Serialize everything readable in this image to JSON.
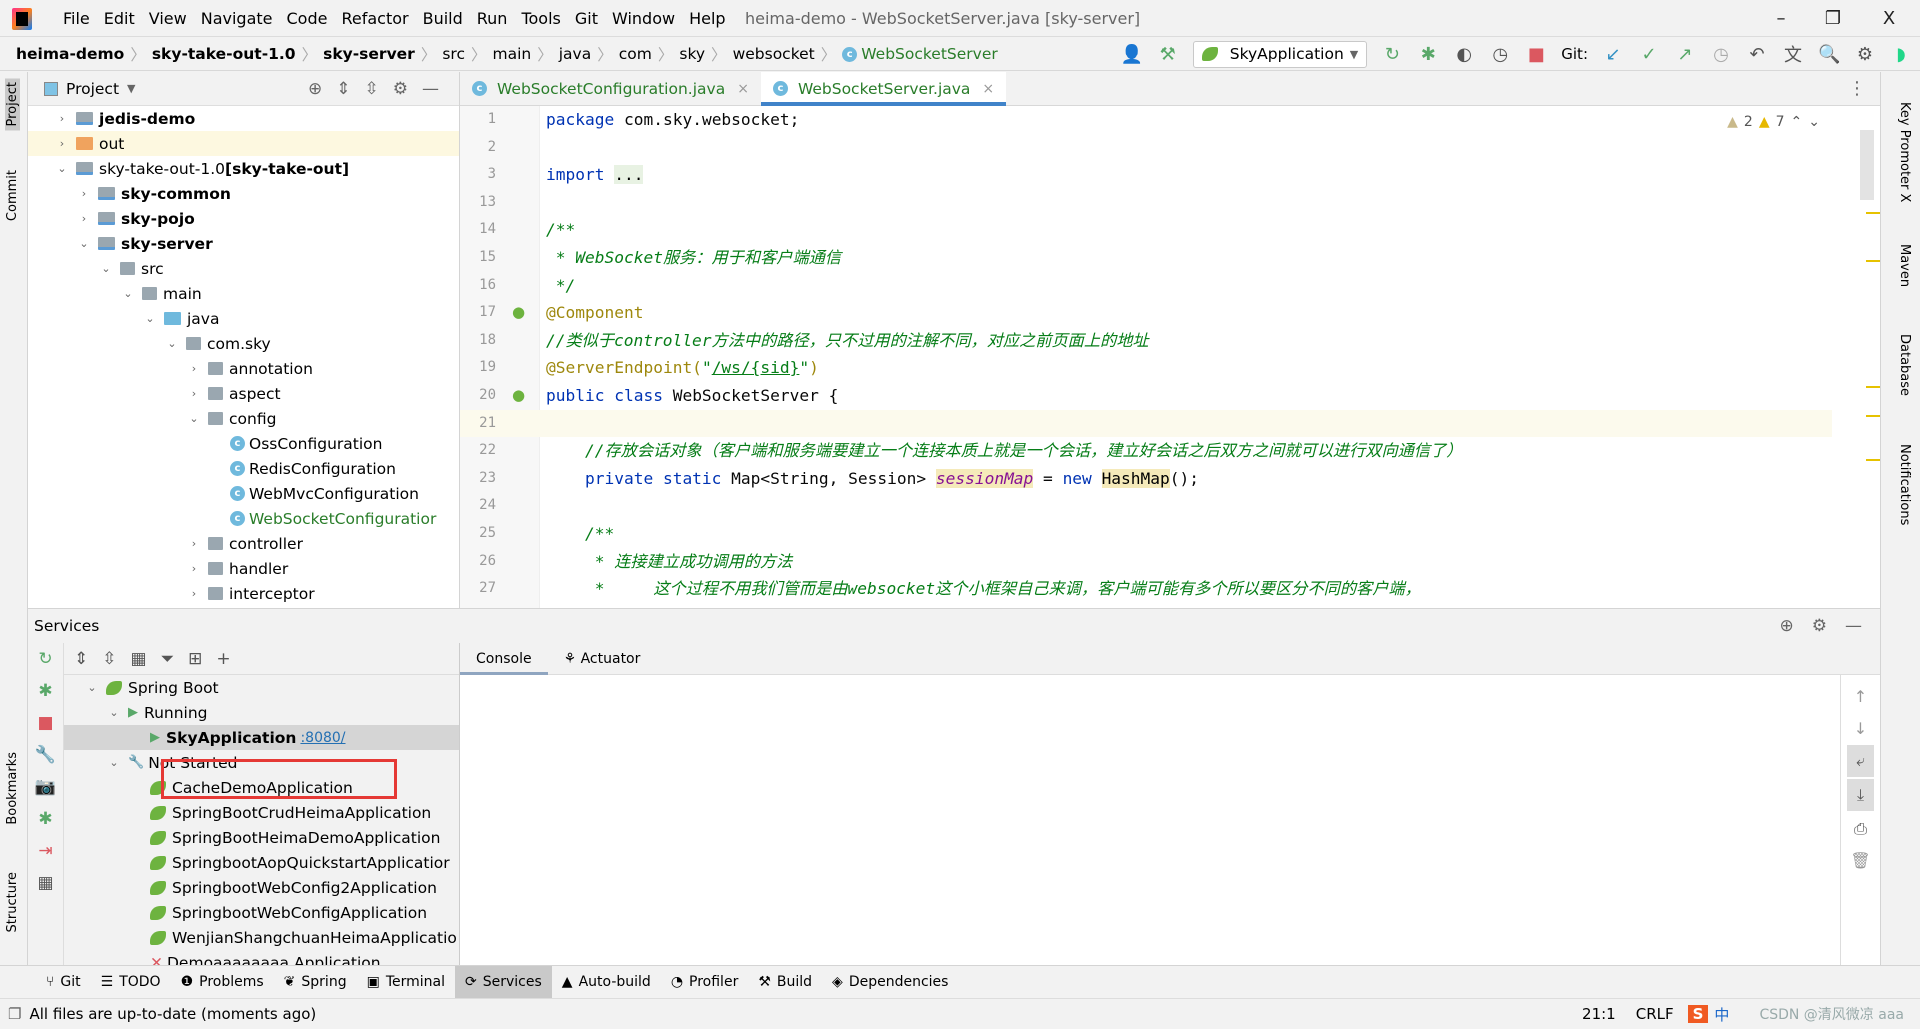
{
  "window": {
    "title": "heima-demo - WebSocketServer.java [sky-server]",
    "minimize": "–",
    "restore": "❐",
    "close": "X"
  },
  "menu": [
    "File",
    "Edit",
    "View",
    "Navigate",
    "Code",
    "Refactor",
    "Build",
    "Run",
    "Tools",
    "Git",
    "Window",
    "Help"
  ],
  "breadcrumb": [
    {
      "label": "heima-demo",
      "bold": true
    },
    {
      "label": "sky-take-out-1.0",
      "bold": true
    },
    {
      "label": "sky-server",
      "bold": true
    },
    {
      "label": "src"
    },
    {
      "label": "main"
    },
    {
      "label": "java"
    },
    {
      "label": "com"
    },
    {
      "label": "sky"
    },
    {
      "label": "websocket"
    },
    {
      "label": "WebSocketServer",
      "cls": true
    }
  ],
  "toolbar": {
    "run_config": "SkyApplication",
    "git_label": "Git:"
  },
  "left_stripe": [
    "Project",
    "Commit",
    "Bookmarks",
    "Structure"
  ],
  "right_stripe": [
    "Key Promoter X",
    "Maven",
    "Database",
    "Notifications"
  ],
  "project": {
    "title": "Project",
    "items": [
      {
        "label": "jedis-demo",
        "level": 0,
        "arrow": "›",
        "icon": "mod",
        "bold": true
      },
      {
        "label": "out",
        "level": 0,
        "arrow": "›",
        "icon": "out",
        "highlight": true
      },
      {
        "label": "sky-take-out-1.0",
        "suffix": " [sky-take-out]",
        "level": 0,
        "arrow": "⌄",
        "icon": "mod"
      },
      {
        "label": "sky-common",
        "level": 1,
        "arrow": "›",
        "icon": "mod",
        "bold": true
      },
      {
        "label": "sky-pojo",
        "level": 1,
        "arrow": "›",
        "icon": "mod",
        "bold": true
      },
      {
        "label": "sky-server",
        "level": 1,
        "arrow": "⌄",
        "icon": "mod",
        "bold": true
      },
      {
        "label": "src",
        "level": 2,
        "arrow": "⌄",
        "icon": "pkg"
      },
      {
        "label": "main",
        "level": 3,
        "arrow": "⌄",
        "icon": "pkg"
      },
      {
        "label": "java",
        "level": 4,
        "arrow": "⌄",
        "icon": "src"
      },
      {
        "label": "com.sky",
        "level": 5,
        "arrow": "⌄",
        "icon": "pkg"
      },
      {
        "label": "annotation",
        "level": 6,
        "arrow": "›",
        "icon": "pkg"
      },
      {
        "label": "aspect",
        "level": 6,
        "arrow": "›",
        "icon": "pkg"
      },
      {
        "label": "config",
        "level": 6,
        "arrow": "⌄",
        "icon": "pkg"
      },
      {
        "label": "OssConfiguration",
        "level": 7,
        "icon": "class"
      },
      {
        "label": "RedisConfiguration",
        "level": 7,
        "icon": "class"
      },
      {
        "label": "WebMvcConfiguration",
        "level": 7,
        "icon": "class"
      },
      {
        "label": "WebSocketConfiguratior",
        "level": 7,
        "icon": "class",
        "green": true
      },
      {
        "label": "controller",
        "level": 6,
        "arrow": "›",
        "icon": "pkg"
      },
      {
        "label": "handler",
        "level": 6,
        "arrow": "›",
        "icon": "pkg"
      },
      {
        "label": "interceptor",
        "level": 6,
        "arrow": "›",
        "icon": "pkg"
      }
    ]
  },
  "editor": {
    "tabs": [
      {
        "label": "WebSocketConfiguration.java",
        "active": false
      },
      {
        "label": "WebSocketServer.java",
        "active": true
      }
    ],
    "inspections": {
      "weak_warnings": "2",
      "warnings": "7"
    },
    "lines": [
      {
        "n": "1",
        "tokens": [
          [
            "kw",
            "package"
          ],
          [
            "plain",
            " com.sky.websocket;"
          ]
        ]
      },
      {
        "n": "2",
        "tokens": []
      },
      {
        "n": "3",
        "tokens": [
          [
            "kw",
            "import"
          ],
          [
            "plain",
            " "
          ],
          [
            "fold",
            "..."
          ]
        ]
      },
      {
        "n": "13",
        "tokens": []
      },
      {
        "n": "14",
        "tokens": [
          [
            "doc",
            "/**"
          ]
        ]
      },
      {
        "n": "15",
        "tokens": [
          [
            "doc",
            " * WebSocket服务：用于和客户端通信"
          ]
        ]
      },
      {
        "n": "16",
        "tokens": [
          [
            "doc",
            " */"
          ]
        ]
      },
      {
        "n": "17",
        "tokens": [
          [
            "ann",
            "@Component"
          ]
        ]
      },
      {
        "n": "18",
        "tokens": [
          [
            "cmt",
            "//类似于controller方法中的路径，只不过用的注解不同，对应之前页面上的地址"
          ]
        ]
      },
      {
        "n": "19",
        "tokens": [
          [
            "ann",
            "@ServerEndpoint("
          ],
          [
            "str",
            "\""
          ],
          [
            "strl",
            "/ws/{sid}"
          ],
          [
            "str",
            "\""
          ],
          [
            "ann",
            ")"
          ]
        ]
      },
      {
        "n": "20",
        "tokens": [
          [
            "kw",
            "public class"
          ],
          [
            "plain",
            " WebSocketServer {"
          ]
        ]
      },
      {
        "n": "21",
        "tokens": [],
        "current": true
      },
      {
        "n": "22",
        "tokens": [
          [
            "plain",
            "    "
          ],
          [
            "cmt",
            "//存放会话对象（客户端和服务端要建立一个连接本质上就是一个会话，建立好会话之后双方之间就可以进行双向通信了）"
          ]
        ]
      },
      {
        "n": "23",
        "tokens": [
          [
            "plain",
            "    "
          ],
          [
            "kw",
            "private static"
          ],
          [
            "plain",
            " Map<String, Session> "
          ],
          [
            "fld",
            "sessionMap"
          ],
          [
            "plain",
            " = "
          ],
          [
            "kw",
            "new"
          ],
          [
            "plain",
            " "
          ],
          [
            "hl",
            "HashMap"
          ],
          [
            "plain",
            "();"
          ]
        ]
      },
      {
        "n": "24",
        "tokens": []
      },
      {
        "n": "25",
        "tokens": [
          [
            "plain",
            "    "
          ],
          [
            "doc",
            "/**"
          ]
        ]
      },
      {
        "n": "26",
        "tokens": [
          [
            "plain",
            "     "
          ],
          [
            "doc",
            "* 连接建立成功调用的方法"
          ]
        ]
      },
      {
        "n": "27",
        "tokens": [
          [
            "plain",
            "     "
          ],
          [
            "doc",
            "*     这个过程不用我们管而是由websocket这个小框架自己来调，客户端可能有多个所以要区分不同的客户端，"
          ]
        ]
      }
    ]
  },
  "services": {
    "title": "Services",
    "console_tabs": [
      "Console",
      "Actuator"
    ],
    "tree": [
      {
        "label": "Spring Boot",
        "level": 0,
        "arrow": "⌄",
        "icon": "spring"
      },
      {
        "label": "Running",
        "level": 1,
        "arrow": "⌄",
        "icon": "run"
      },
      {
        "label": "SkyApplication",
        "link": ":8080/",
        "level": 2,
        "icon": "run",
        "selected": true,
        "bold": true
      },
      {
        "label": "Not Started",
        "level": 1,
        "arrow": "⌄",
        "icon": "wrench"
      },
      {
        "label": "CacheDemoApplication",
        "level": 2,
        "icon": "spring"
      },
      {
        "label": "SpringBootCrudHeimaApplication",
        "level": 2,
        "icon": "spring"
      },
      {
        "label": "SpringBootHeimaDemoApplication",
        "level": 2,
        "icon": "spring"
      },
      {
        "label": "SpringbootAopQuickstartApplicatior",
        "level": 2,
        "icon": "spring"
      },
      {
        "label": "SpringbootWebConfig2Application",
        "level": 2,
        "icon": "spring"
      },
      {
        "label": "SpringbootWebConfigApplication",
        "level": 2,
        "icon": "spring"
      },
      {
        "label": "WenjianShangchuanHeimaApplicatio",
        "level": 2,
        "icon": "spring"
      },
      {
        "label": "Demoaaaaaaaa Application",
        "level": 2,
        "icon": "error"
      }
    ]
  },
  "tool_windows": [
    {
      "label": "Git",
      "icon": "⑂"
    },
    {
      "label": "TODO",
      "icon": "☰"
    },
    {
      "label": "Problems",
      "icon": "❶"
    },
    {
      "label": "Spring",
      "icon": "❦"
    },
    {
      "label": "Terminal",
      "icon": "▣"
    },
    {
      "label": "Services",
      "icon": "⟳",
      "active": true
    },
    {
      "label": "Auto-build",
      "icon": "▲"
    },
    {
      "label": "Profiler",
      "icon": "◔"
    },
    {
      "label": "Build",
      "icon": "⚒"
    },
    {
      "label": "Dependencies",
      "icon": "◈"
    }
  ],
  "status": {
    "message": "All files are up-to-date (moments ago)",
    "position": "21:1",
    "line_sep": "CRLF",
    "ime": "中",
    "watermark": "CSDN @清风微凉 aaa"
  },
  "colors": {
    "accent": "#4083c9",
    "selection_box": "#e53935",
    "run_green": "#59a869",
    "stop_red": "#db5860"
  }
}
